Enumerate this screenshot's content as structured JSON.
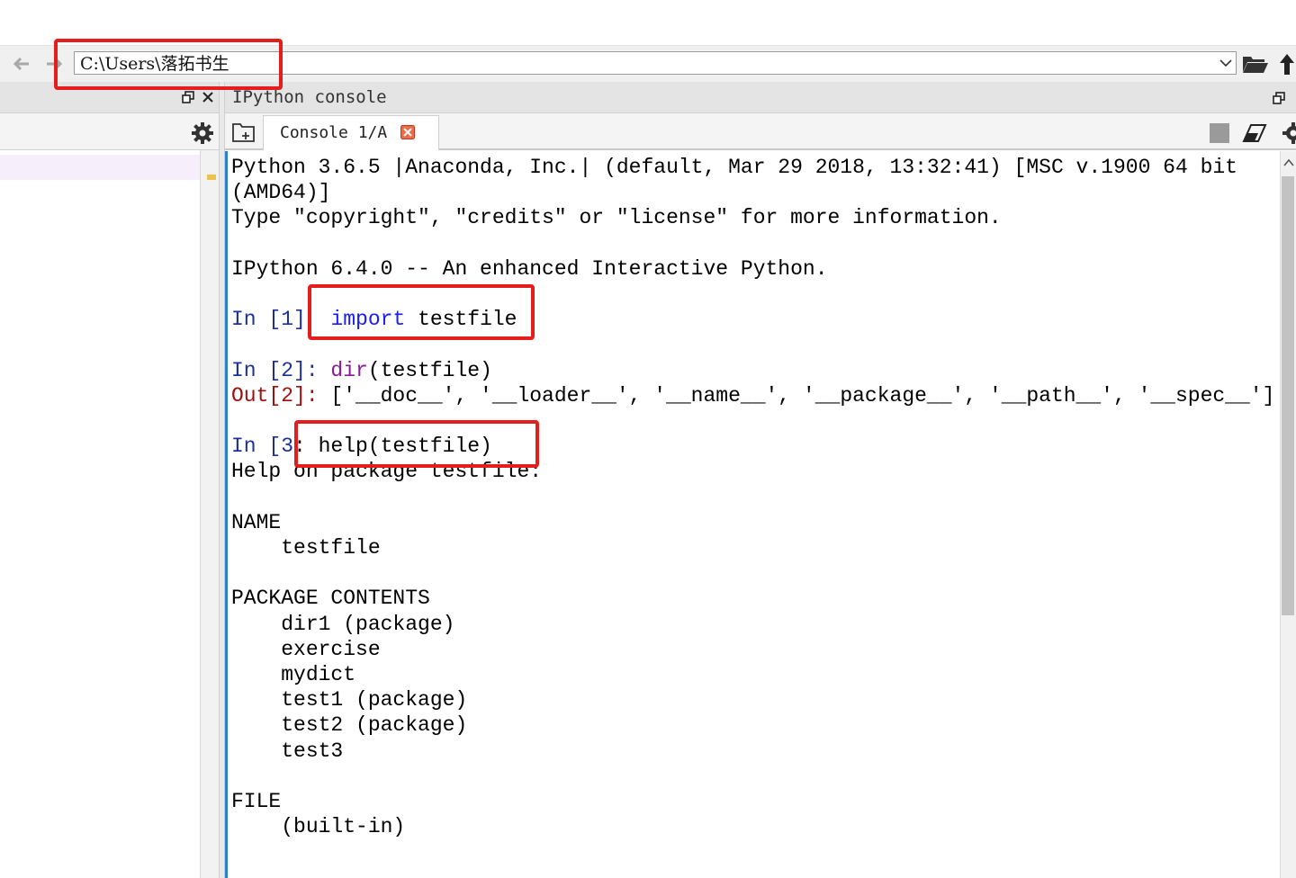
{
  "toolbar": {
    "path": "C:\\Users\\落拓书生"
  },
  "console_pane": {
    "title": "IPython console",
    "tab_label": "Console 1/A"
  },
  "console": {
    "banner_1": "Python 3.6.5 |Anaconda, Inc.| (default, Mar 29 2018, 13:32:41) [MSC v.1900 64 bit",
    "banner_2": "(AMD64)]",
    "banner_3": "Type \"copyright\", \"credits\" or \"license\" for more information.",
    "banner_4": "IPython 6.4.0 -- An enhanced Interactive Python.",
    "in1_prompt": "In [1]",
    "in1_keyword": "import",
    "in1_rest": " testfile",
    "in2_prompt": "In [2]: ",
    "in2_builtin": "dir",
    "in2_rest": "(testfile)",
    "out2_prompt": "Out[2]: ",
    "out2_value": "['__doc__', '__loader__', '__name__', '__package__', '__path__', '__spec__']",
    "in3_prompt": "In [3",
    "in3_rest": ": help(testfile)",
    "help_header": "Help on package testfile:",
    "name_heading": "NAME",
    "name_value": "    testfile",
    "contents_heading": "PACKAGE CONTENTS",
    "contents_items": [
      "    dir1 (package)",
      "    exercise",
      "    mydict",
      "    test1 (package)",
      "    test2 (package)",
      "    test3"
    ],
    "file_heading": "FILE",
    "file_value": "    (built-in)"
  },
  "colors": {
    "annotation": "#e41d1d",
    "keyword": "#1a1aff",
    "builtin": "#8a1a9a",
    "in_prompt": "#1c2f9c",
    "out_prompt": "#a01010",
    "console_focus": "#2b7fd0"
  },
  "icons": [
    "back-arrow-icon",
    "forward-arrow-icon",
    "chevron-down-icon",
    "open-folder-icon",
    "up-arrow-icon",
    "undock-icon",
    "close-icon",
    "gear-icon",
    "new-folder-icon",
    "tab-close-icon",
    "stop-icon",
    "eraser-icon"
  ]
}
